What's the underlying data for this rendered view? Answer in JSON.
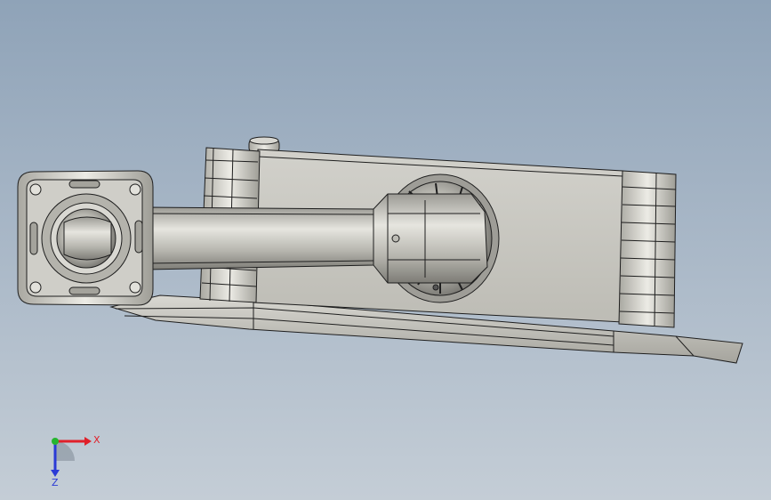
{
  "viewport": {
    "background_top": "#8fa3b8",
    "background_bottom": "#c4cdd6",
    "part_color": "#c7c6c0",
    "edge_color": "#1e1e1e"
  },
  "triad": {
    "x_label": "X",
    "z_label": "Z",
    "x_color": "#e0202a",
    "y_color": "#25b52f",
    "z_color": "#2a3ad6"
  }
}
